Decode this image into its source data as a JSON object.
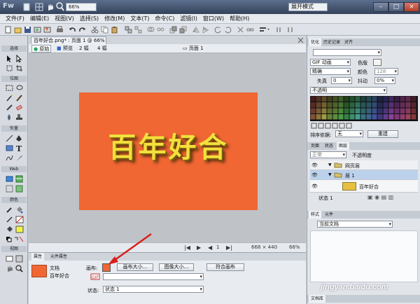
{
  "window": {
    "app_logo": "Fw",
    "zoom": "66%",
    "mode": "展开模式",
    "minimize": "–",
    "maximize": "□",
    "close": "×"
  },
  "menu": [
    "文件(F)",
    "编辑(E)",
    "视图(V)",
    "选择(S)",
    "修改(M)",
    "文本(T)",
    "命令(C)",
    "滤镜(I)",
    "窗口(W)",
    "帮助(H)"
  ],
  "tools": {
    "select": "选择",
    "bitmap": "位图",
    "vector": "矢量",
    "web": "Web",
    "colors": "颜色",
    "view": "视图"
  },
  "document": {
    "tab": "百年好合.png* : 页面 1 @ 66%",
    "views": [
      "原始",
      "预览",
      "2 幅",
      "4 幅"
    ],
    "page": "页面 1",
    "artboard_text": "百年好合",
    "status_page": "1",
    "status_size": "668 × 440",
    "status_zoom": "66%"
  },
  "properties": {
    "tab1": "属性",
    "tab2": "元件属性",
    "doc_label": "文档",
    "doc_name": "百年好合",
    "canvas_label": "画布:",
    "btn_canvas_size": "画布大小...",
    "btn_image_size": "图像大小...",
    "btn_fit_canvas": "符合画布",
    "state_label": "状态:",
    "state_value": "状态 1",
    "canvas_color": "#f06733"
  },
  "optimize": {
    "tabs": [
      "优化",
      "历史记录",
      "对齐"
    ],
    "format": "GIF 动画",
    "matte": "色版",
    "dither": "精确",
    "colors_label": "颜色",
    "colors_value": "128",
    "loss_label": "失真",
    "loss_value": "0",
    "dither2_label": "抖动",
    "dither2_value": "0%",
    "transparency": "不透明",
    "sort_label": "排序依据:",
    "sort_value": "无",
    "rebuild": "重建"
  },
  "layers": {
    "tabs": [
      "页面",
      "状态",
      "图层"
    ],
    "blend": "正常",
    "opacity": "不透明度",
    "rows": [
      {
        "name": "网页层"
      },
      {
        "name": "层 1"
      },
      {
        "name": "百年好合"
      }
    ],
    "state": "状态 1"
  },
  "styles": {
    "tabs": [
      "样式",
      "元件"
    ],
    "current": "当前文档",
    "bottom_tabs": [
      "文档库"
    ]
  },
  "watermark": "jingyan.baidu.com"
}
